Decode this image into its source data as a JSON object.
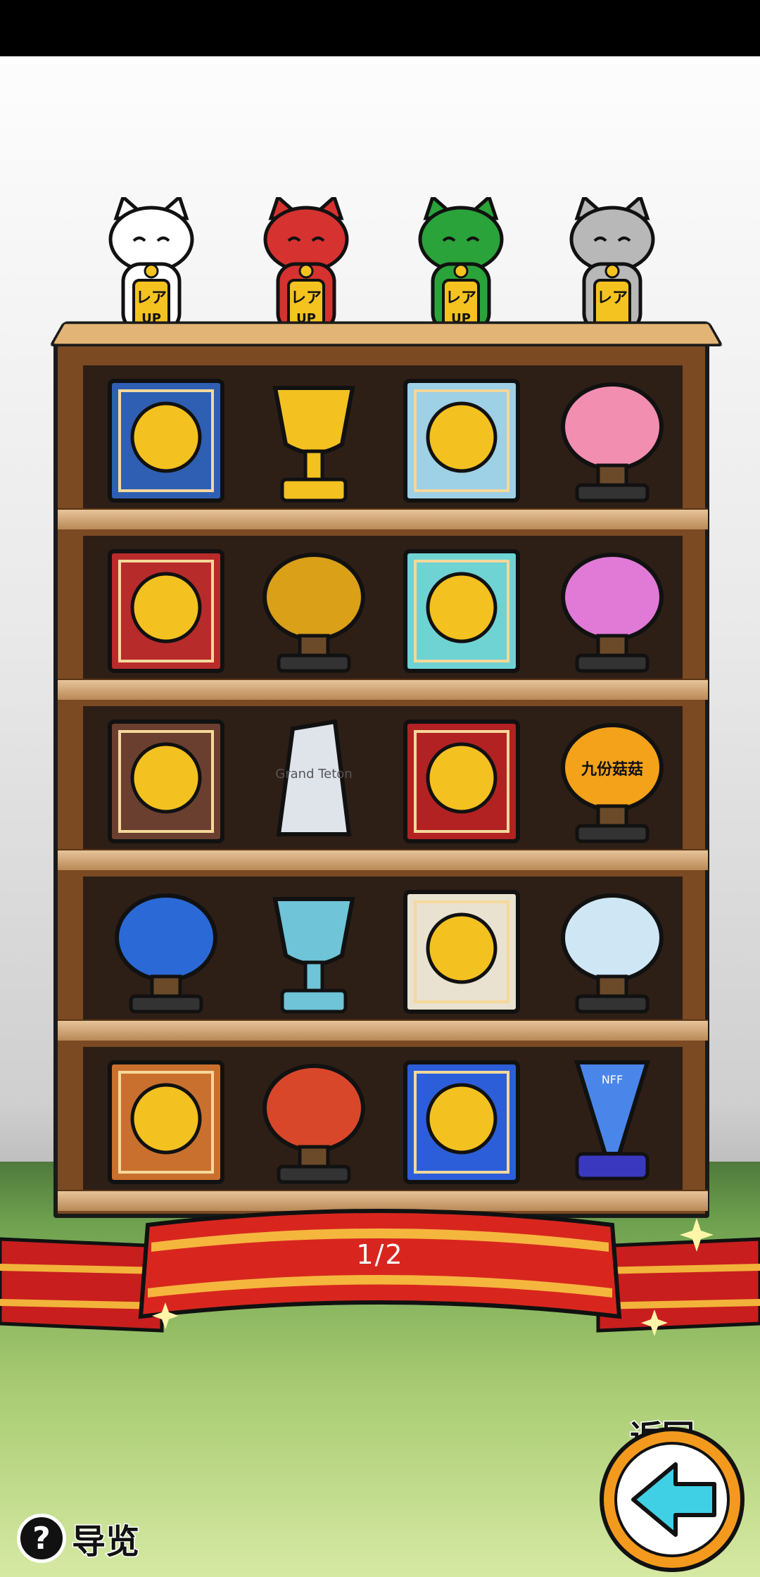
{
  "status_bar": {},
  "cats": [
    {
      "name": "white-lucky-cat",
      "badge_top": "レア",
      "badge_bottom": "UP",
      "color": "#ffffff"
    },
    {
      "name": "red-lucky-cat",
      "badge_top": "レア",
      "badge_bottom": "UP",
      "color": "#d6322f"
    },
    {
      "name": "green-lucky-cat",
      "badge_top": "レア",
      "badge_bottom": "UP",
      "color": "#2aa33a"
    },
    {
      "name": "silver-lucky-cat",
      "badge_top": "レア",
      "badge_bottom": "",
      "color": "#b8b8b8"
    }
  ],
  "shelf": {
    "rows": [
      [
        "gold-coin-plaque",
        "gold-trophy-red-ribbon",
        "lotus-ice-plaque",
        "lotus-statue"
      ],
      [
        "maple-leaf-plaque",
        "golden-eagle-statue",
        "turquoise-coral-plaque",
        "coral-flower-statue"
      ],
      [
        "mountain-plaque",
        "crystal-grand-teton-trophy",
        "double-happiness-plaque",
        "jiufen-lantern"
      ],
      [
        "evil-eye-statue",
        "teal-jeweled-cup",
        "mascot-framed-plaque",
        "greek-temple-statue"
      ],
      [
        "madagascar-coin-plaque",
        "baobab-tree-pot",
        "submarine-ocean-plaque",
        "blue-cone-trophy"
      ]
    ],
    "labels": {
      "crystal_text": "Grand Teton",
      "lantern_text": "九份菇菇",
      "cone_text": "NFF"
    }
  },
  "pagination": {
    "label": "1/2"
  },
  "back_button": {
    "label": "返回"
  },
  "guide_button": {
    "icon": "?",
    "label": "导览"
  }
}
